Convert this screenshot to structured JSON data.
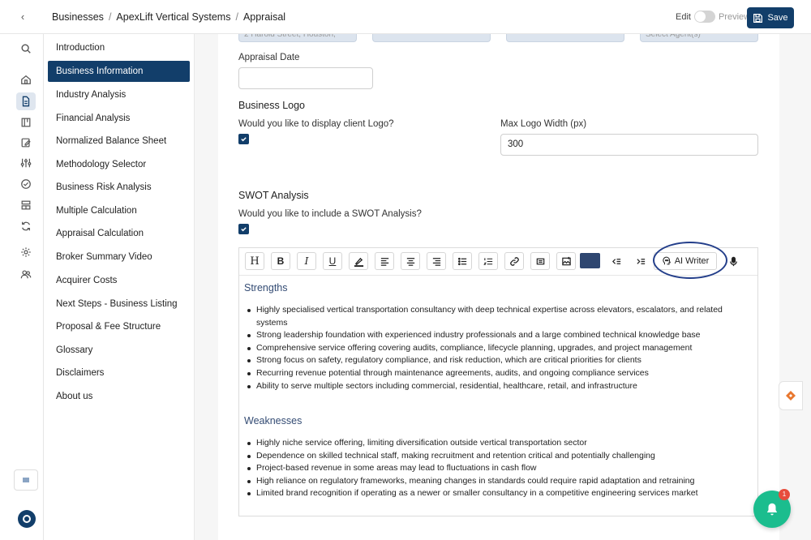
{
  "header": {
    "breadcrumb": [
      "Businesses",
      "ApexLift Vertical Systems",
      "Appraisal"
    ],
    "edit_label": "Edit",
    "preview_label": "Preview",
    "save_label": "Save"
  },
  "rail": {
    "icons": [
      "search-icon",
      "home-icon",
      "document-icon",
      "calendar-icon",
      "edit-icon",
      "sliders-icon",
      "check-circle-icon",
      "layout-icon",
      "refresh-icon",
      "settings-icon",
      "users-icon"
    ],
    "active": "document-icon"
  },
  "sections": {
    "items": [
      "Introduction",
      "Business Information",
      "Industry Analysis",
      "Financial Analysis",
      "Normalized Balance Sheet",
      "Methodology Selector",
      "Business Risk Analysis",
      "Multiple Calculation",
      "Appraisal Calculation",
      "Broker Summary Video",
      "Acquirer Costs",
      "Next Steps - Business Listing",
      "Proposal & Fee Structure",
      "Glossary",
      "Disclaimers",
      "About us"
    ],
    "active_index": 1
  },
  "form": {
    "address_partial": "2 Harold Street, Houston,",
    "agent_partial": "Select Agent(s)",
    "appraisal_date_label": "Appraisal Date",
    "appraisal_date_value": "",
    "business_logo_heading": "Business Logo",
    "display_logo_question": "Would you like to display client Logo?",
    "display_logo_checked": true,
    "max_logo_width_label": "Max Logo Width (px)",
    "max_logo_width_value": "300",
    "swot_heading": "SWOT Analysis",
    "swot_question": "Would you like to include a SWOT Analysis?",
    "swot_checked": true
  },
  "editor": {
    "toolbar": {
      "heading_label": "H",
      "bold_label": "B",
      "italic_label": "I",
      "underline_label": "U",
      "ai_writer_label": "AI Writer",
      "text_color": "#2e4670"
    },
    "strengths_heading": "Strengths",
    "strengths": [
      "Highly specialised vertical transportation consultancy with deep technical expertise across elevators, escalators, and related systems",
      "Strong leadership foundation with experienced industry professionals and a large combined technical knowledge base",
      "Comprehensive service offering covering audits, compliance, lifecycle planning, upgrades, and project management",
      "Strong focus on safety, regulatory compliance, and risk reduction, which are critical priorities for clients",
      "Recurring revenue potential through maintenance agreements, audits, and ongoing compliance services",
      "Ability to serve multiple sectors including commercial, residential, healthcare, retail, and infrastructure"
    ],
    "weaknesses_heading": "Weaknesses",
    "weaknesses": [
      "Highly niche service offering, limiting diversification outside vertical transportation sector",
      "Dependence on skilled technical staff, making recruitment and retention critical and potentially challenging",
      "Project-based revenue in some areas may lead to fluctuations in cash flow",
      "High reliance on regulatory frameworks, meaning changes in standards could require rapid adaptation and retraining",
      "Limited brand recognition if operating as a newer or smaller consultancy in a competitive engineering services market"
    ]
  },
  "notifications": {
    "count": "1"
  },
  "colors": {
    "primary": "#123e6a",
    "fab": "#1bbd8e",
    "badge": "#e74c3c"
  }
}
